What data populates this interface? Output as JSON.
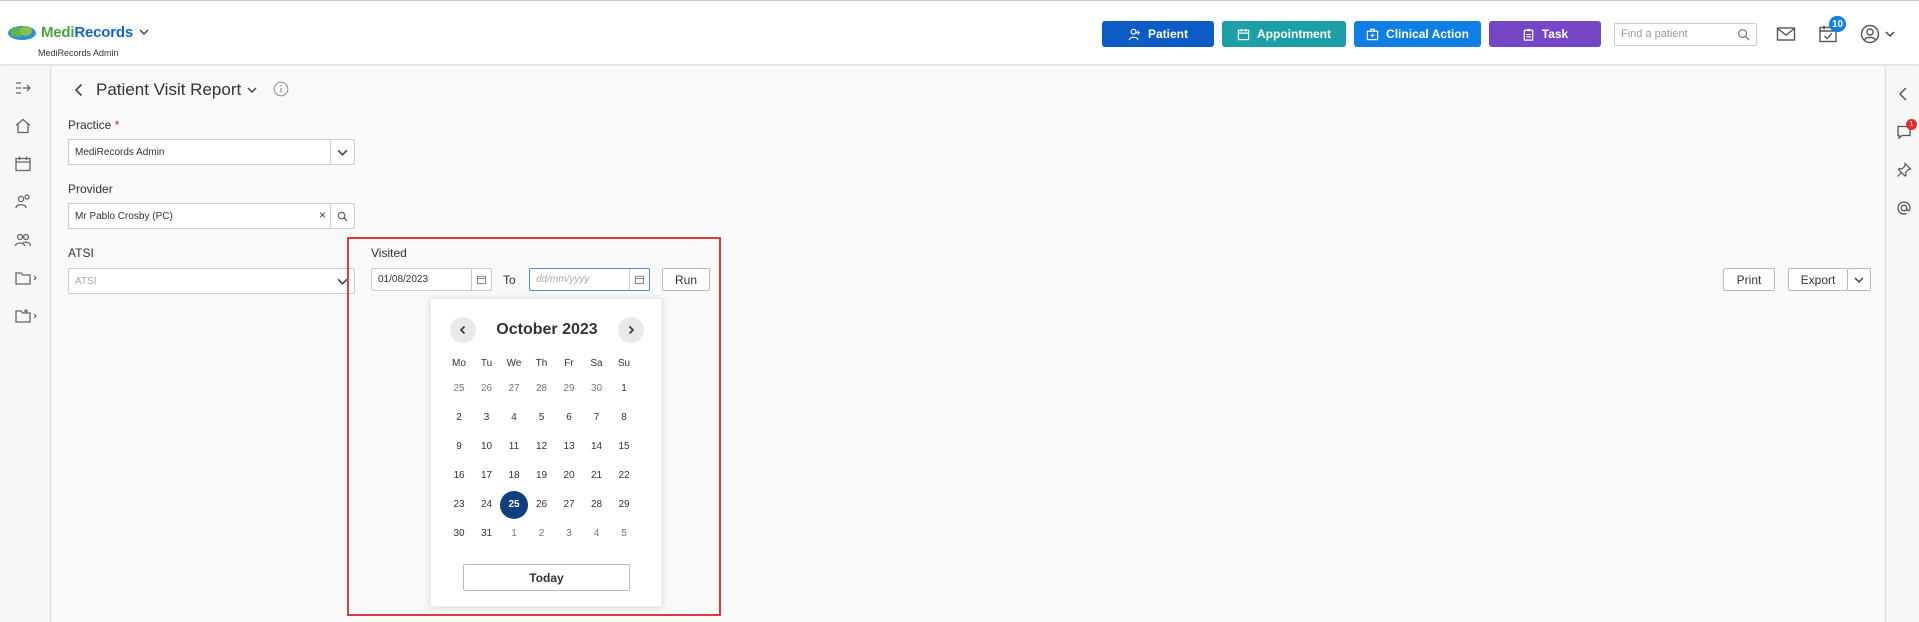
{
  "header": {
    "logo_text_medi": "Medi",
    "logo_text_records": "Records",
    "org_name": "MediRecords Admin",
    "buttons": {
      "patient": "Patient",
      "appointment": "Appointment",
      "clinical_action": "Clinical Action",
      "task": "Task"
    },
    "search_placeholder": "Find a patient",
    "tasks_badge": "10"
  },
  "page": {
    "title": "Patient Visit Report"
  },
  "form": {
    "practice_label": "Practice",
    "practice_required": "*",
    "practice_value": "MediRecords Admin",
    "provider_label": "Provider",
    "provider_value": "Mr Pablo Crosby (PC)",
    "provider_clear": "×",
    "atsi_label": "ATSI",
    "atsi_placeholder": "ATSI",
    "visited_label": "Visited",
    "visited_from": "01/08/2023",
    "to_label": "To",
    "visited_to_placeholder": "dd/mm/yyyy",
    "run_label": "Run",
    "print_label": "Print",
    "export_label": "Export"
  },
  "right_rail": {
    "notification_count": "1"
  },
  "calendar": {
    "month_label": "October 2023",
    "weekdays": [
      "Mo",
      "Tu",
      "We",
      "Th",
      "Fr",
      "Sa",
      "Su"
    ],
    "weeks": [
      [
        {
          "d": "25",
          "m": 1
        },
        {
          "d": "26",
          "m": 1
        },
        {
          "d": "27",
          "m": 1
        },
        {
          "d": "28",
          "m": 1
        },
        {
          "d": "29",
          "m": 1
        },
        {
          "d": "30",
          "m": 1
        },
        {
          "d": "1",
          "m": 0
        }
      ],
      [
        {
          "d": "2",
          "m": 0
        },
        {
          "d": "3",
          "m": 0
        },
        {
          "d": "4",
          "m": 0
        },
        {
          "d": "5",
          "m": 0
        },
        {
          "d": "6",
          "m": 0
        },
        {
          "d": "7",
          "m": 0
        },
        {
          "d": "8",
          "m": 0
        }
      ],
      [
        {
          "d": "9",
          "m": 0
        },
        {
          "d": "10",
          "m": 0
        },
        {
          "d": "11",
          "m": 0
        },
        {
          "d": "12",
          "m": 0
        },
        {
          "d": "13",
          "m": 0
        },
        {
          "d": "14",
          "m": 0
        },
        {
          "d": "15",
          "m": 0
        }
      ],
      [
        {
          "d": "16",
          "m": 0
        },
        {
          "d": "17",
          "m": 0
        },
        {
          "d": "18",
          "m": 0
        },
        {
          "d": "19",
          "m": 0
        },
        {
          "d": "20",
          "m": 0
        },
        {
          "d": "21",
          "m": 0
        },
        {
          "d": "22",
          "m": 0
        }
      ],
      [
        {
          "d": "23",
          "m": 0
        },
        {
          "d": "24",
          "m": 0
        },
        {
          "d": "25",
          "m": 0,
          "sel": 1
        },
        {
          "d": "26",
          "m": 0
        },
        {
          "d": "27",
          "m": 0
        },
        {
          "d": "28",
          "m": 0
        },
        {
          "d": "29",
          "m": 0
        }
      ],
      [
        {
          "d": "30",
          "m": 0
        },
        {
          "d": "31",
          "m": 0
        },
        {
          "d": "1",
          "m": 1
        },
        {
          "d": "2",
          "m": 1
        },
        {
          "d": "3",
          "m": 1
        },
        {
          "d": "4",
          "m": 1
        },
        {
          "d": "5",
          "m": 1
        }
      ]
    ],
    "today_label": "Today"
  },
  "colors": {
    "patient_btn": "#0d5bc5",
    "appointment_btn": "#1aa0a6",
    "clinical_btn": "#0f7fe6",
    "task_btn": "#7547c6",
    "selected_day": "#0e3f7e",
    "highlight_border": "#e03a3a"
  }
}
